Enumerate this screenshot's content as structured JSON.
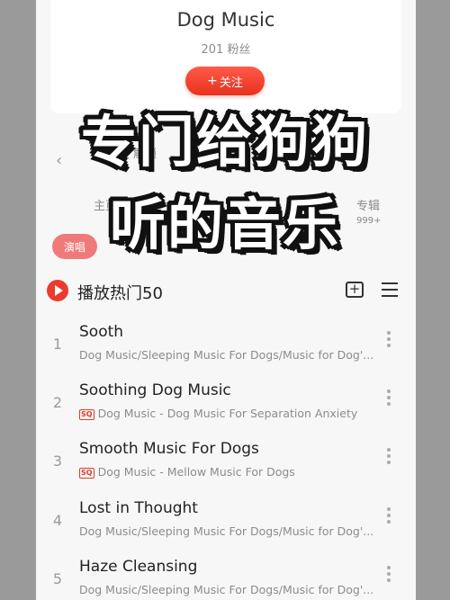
{
  "artist": {
    "name": "Dog Music",
    "fans": "201 粉丝",
    "follow_plus": "+",
    "follow_label": "关注"
  },
  "faded_bar": {
    "vip_text": "会员",
    "vip_badge": "",
    "unlock_text": "解锁",
    "back_glyph": "‹",
    "tabs": {
      "songs": "主页",
      "videos": "歌曲",
      "albums": "专辑",
      "albums_count": "999+"
    }
  },
  "tag": {
    "label": "演唱"
  },
  "overlay": {
    "line1": "专门给狗狗",
    "line2": "听的音乐"
  },
  "section": {
    "title": "播放热门50"
  },
  "tracks": [
    {
      "num": "1",
      "title": "Sooth",
      "sq": false,
      "subtitle": "Dog Music/Sleeping Music For Dogs/Music for Dog'..."
    },
    {
      "num": "2",
      "title": "Soothing Dog Music",
      "sq": true,
      "sq_label": "SQ",
      "subtitle": "Dog Music - Dog Music For Separation Anxiety"
    },
    {
      "num": "3",
      "title": "Smooth Music For Dogs",
      "sq": true,
      "sq_label": "SQ",
      "subtitle": "Dog Music - Mellow Music For Dogs"
    },
    {
      "num": "4",
      "title": "Lost in Thought",
      "sq": false,
      "subtitle": "Dog Music/Sleeping Music For Dogs/Music for Dog'..."
    },
    {
      "num": "5",
      "title": "Haze Cleansing",
      "sq": false,
      "subtitle": "Dog Music/Sleeping Music For Dogs/Music for Dog'..."
    }
  ],
  "colors": {
    "accent": "#ec3b2e",
    "follow_button": "#ef3f2c",
    "tag_pill": "#f07a7a",
    "side_strip": "#9a9a9a"
  },
  "icons": {
    "play_all": "play-circle-icon",
    "add_to_list": "add-playlist-icon",
    "menu": "menu-lines-icon",
    "more": "more-vertical-icon"
  }
}
